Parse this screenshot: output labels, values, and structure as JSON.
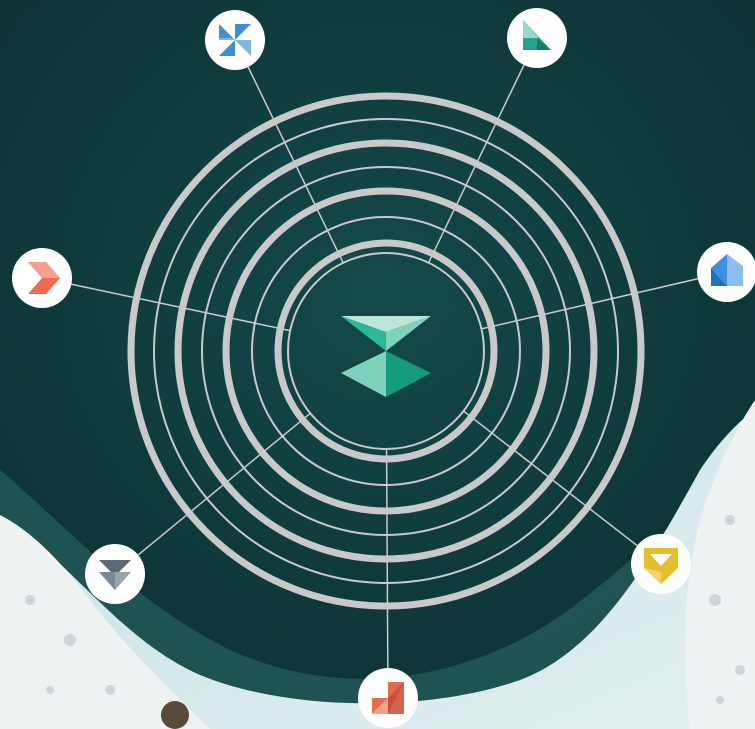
{
  "background": {
    "water_color": "#0f3a3b",
    "ice_color": "#d5e8ea",
    "snow_color": "#eef2f3"
  },
  "diagram": {
    "ring_color": "#c9c9cc",
    "spoke_color": "#c9c9cc",
    "node_bg": "#ffffff",
    "center_logo": {
      "icon": "hourglass-logo-icon",
      "colors": [
        "#bfe6da",
        "#2bb89a",
        "#7fd3bd",
        "#159c7d"
      ]
    },
    "nodes": [
      {
        "icon": "pinwheel-icon",
        "color": "#3a8fd0"
      },
      {
        "icon": "triangles-icon",
        "color": "#24a48c"
      },
      {
        "icon": "cube-icon",
        "color": "#3f8fe0"
      },
      {
        "icon": "shield-icon",
        "color": "#e4bf2b"
      },
      {
        "icon": "stairs-icon",
        "color": "#e26b53"
      },
      {
        "icon": "funnel-icon",
        "color": "#5b6875"
      },
      {
        "icon": "chevron-right-icon",
        "color": "#ef6a4e"
      }
    ]
  }
}
